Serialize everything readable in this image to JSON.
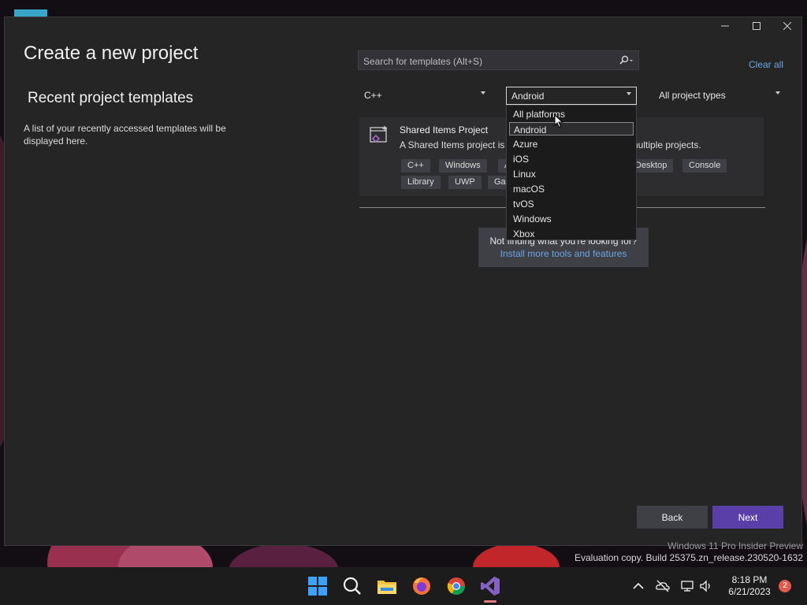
{
  "dialog": {
    "title": "Create a new project",
    "recent_heading": "Recent project templates",
    "recent_desc": "A list of your recently accessed templates will be displayed here.",
    "search_placeholder": "Search for templates (Alt+S)",
    "clear_all": "Clear all",
    "filters": {
      "language": "C++",
      "platform": "Android",
      "project_type": "All project types"
    },
    "template": {
      "name": "Shared Items Project",
      "desc_left": "A Shared Items project is u",
      "desc_right": "nultiple projects.",
      "tags": [
        "C++",
        "Windows",
        "A",
        "Desktop",
        "Console",
        "Library",
        "UWP",
        "Ga"
      ]
    },
    "platform_options": [
      "All platforms",
      "Android",
      "Azure",
      "iOS",
      "Linux",
      "macOS",
      "tvOS",
      "Windows",
      "Xbox"
    ],
    "platform_selected": "Android",
    "not_finding": "Not finding what you're looking for?",
    "install_link": "Install more tools and features",
    "back_label": "Back",
    "next_label": "Next"
  },
  "watermark": {
    "line1": "Windows 11 Pro Insider Preview",
    "line2": "Evaluation copy. Build 25375.zn_release.230520-1632"
  },
  "taskbar": {
    "time": "8:18 PM",
    "date": "6/21/2023",
    "notifications": "2",
    "apps": [
      "windows-start-icon",
      "search-icon",
      "file-explorer-icon",
      "firefox-icon",
      "chrome-icon",
      "visual-studio-icon"
    ]
  },
  "colors": {
    "accent_next": "#5b3fa8",
    "link": "#6aa6e2",
    "dialog_bg": "#252526"
  }
}
